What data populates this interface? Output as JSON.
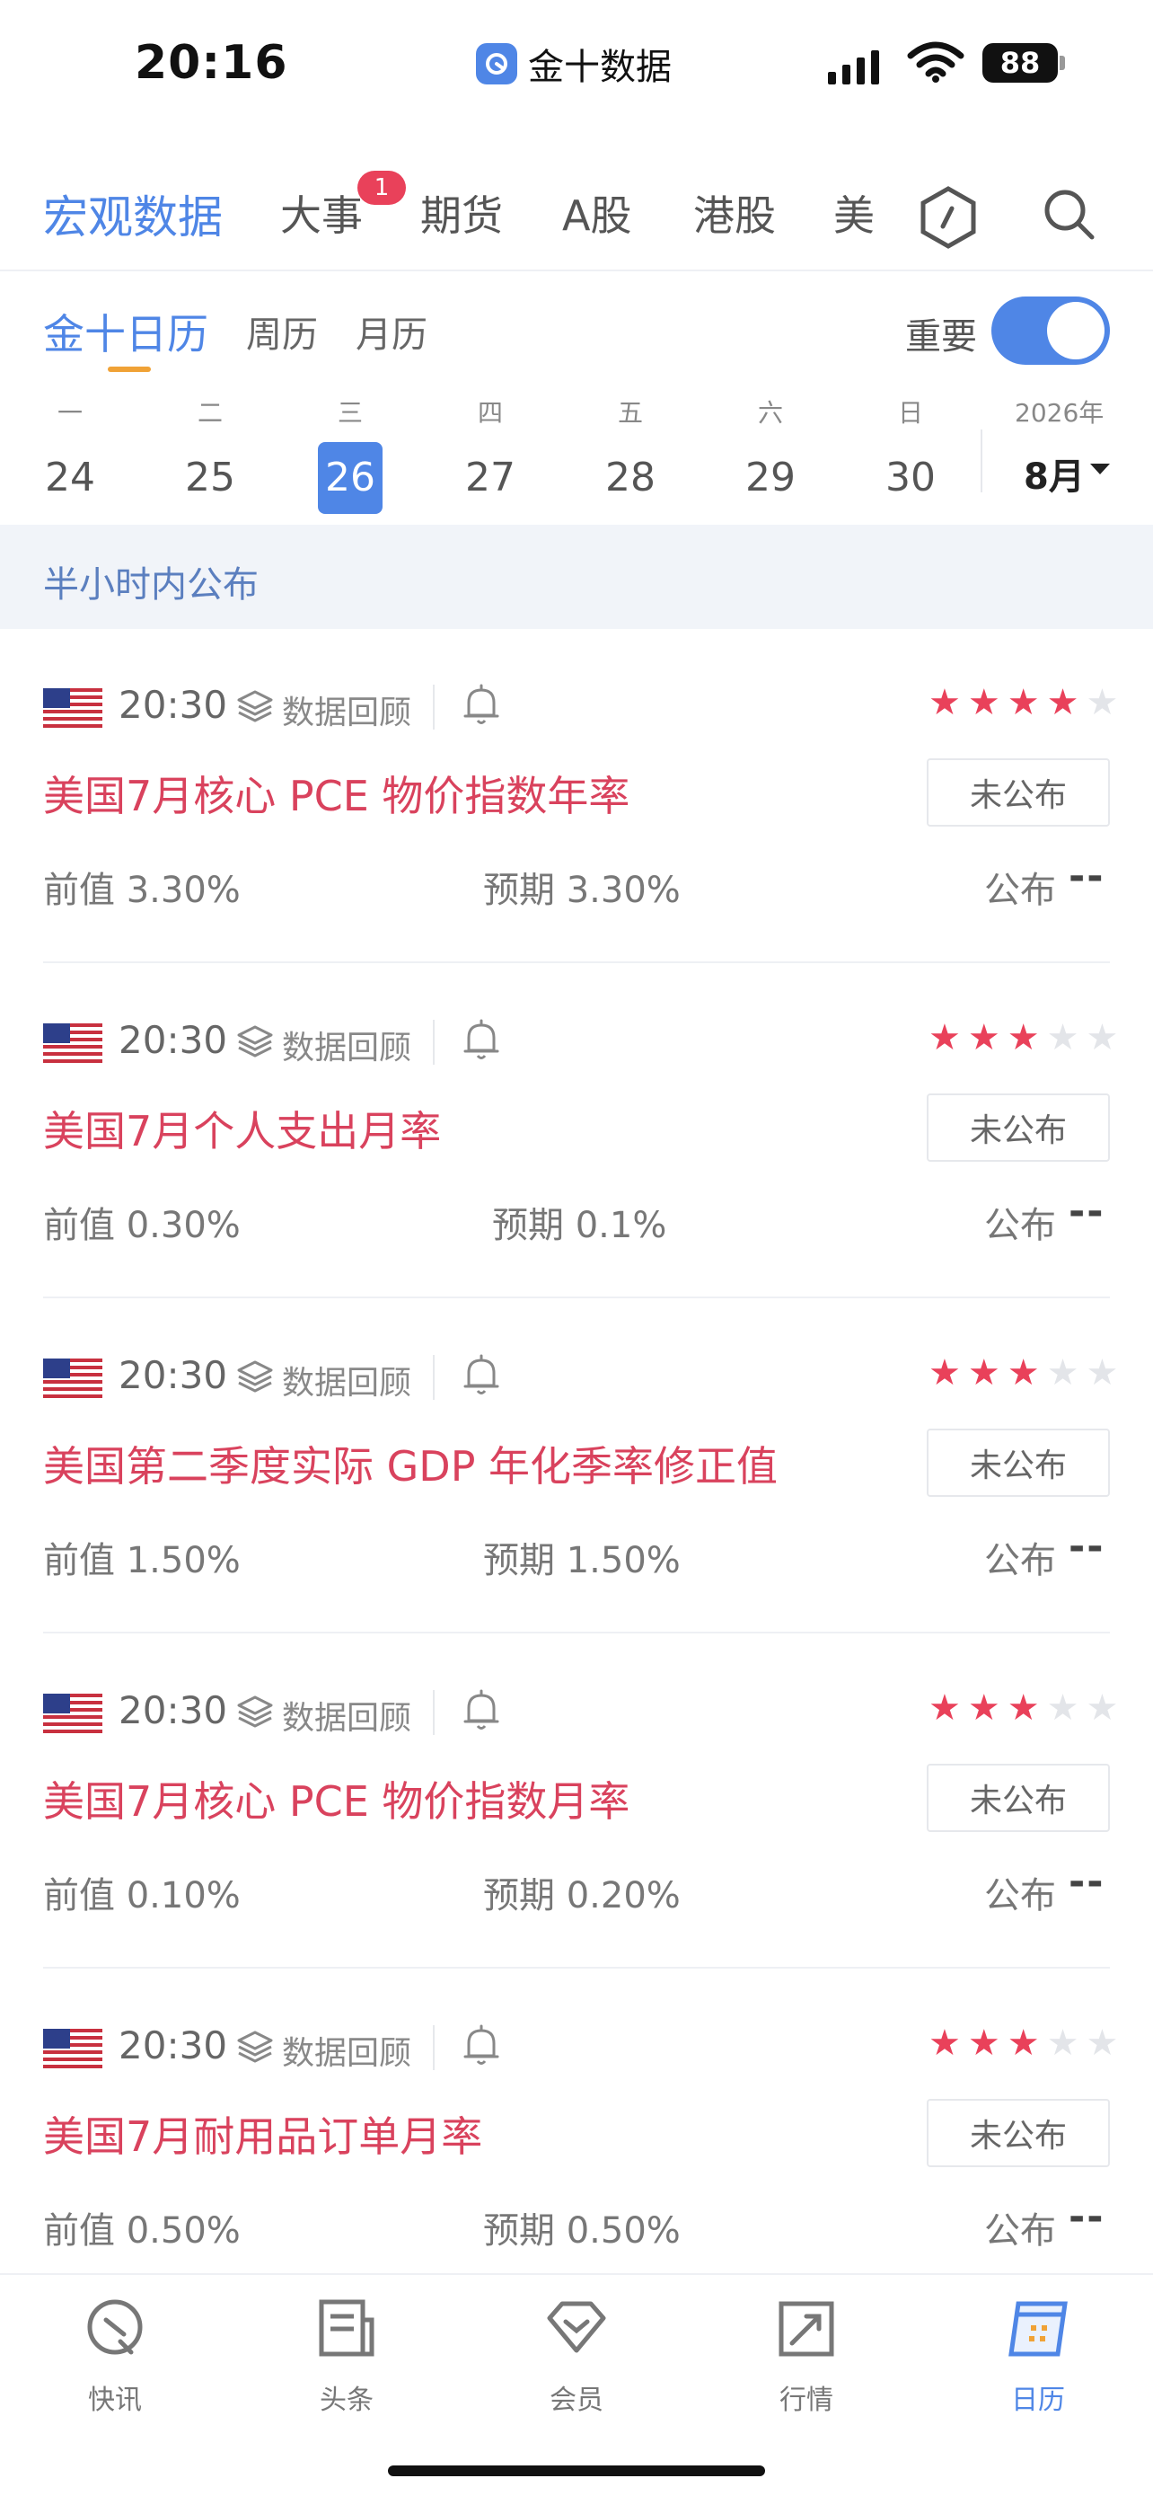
{
  "status_bar": {
    "time": "20:16",
    "app_name": "金十数据",
    "battery": "88"
  },
  "top_tabs": [
    {
      "label": "宏观数据",
      "active": true
    },
    {
      "label": "大事",
      "badge": "1"
    },
    {
      "label": "期货"
    },
    {
      "label": "A股"
    },
    {
      "label": "港股"
    },
    {
      "label": "美"
    }
  ],
  "top_icons": [
    "hexagon-icon",
    "search-icon"
  ],
  "sub_tabs": [
    {
      "label": "金十日历",
      "active": true
    },
    {
      "label": "周历"
    },
    {
      "label": "月历"
    }
  ],
  "important_toggle": {
    "label": "重要",
    "on": true
  },
  "week": {
    "weekdays": [
      "一",
      "二",
      "三",
      "四",
      "五",
      "六",
      "日"
    ],
    "days": [
      "24",
      "25",
      "26",
      "27",
      "28",
      "29",
      "30"
    ],
    "active_day": "26",
    "year": "2026年",
    "month": "8月"
  },
  "section": {
    "title": "半小时内公布"
  },
  "events": [
    {
      "time": "20:30",
      "review": "数据回顾",
      "stars": 4,
      "title": "美国7月核心 PCE 物价指数年率",
      "status": "未公布",
      "prev_label": "前值",
      "prev": "3.30%",
      "forecast_label": "预期",
      "forecast": "3.30%",
      "actual_label": "公布",
      "actual": "--"
    },
    {
      "time": "20:30",
      "review": "数据回顾",
      "stars": 3,
      "title": "美国7月个人支出月率",
      "status": "未公布",
      "prev_label": "前值",
      "prev": "0.30%",
      "forecast_label": "预期",
      "forecast": "0.1%",
      "actual_label": "公布",
      "actual": "--"
    },
    {
      "time": "20:30",
      "review": "数据回顾",
      "stars": 3,
      "title": "美国第二季度实际 GDP 年化季率修正值",
      "status": "未公布",
      "prev_label": "前值",
      "prev": "1.50%",
      "forecast_label": "预期",
      "forecast": "1.50%",
      "actual_label": "公布",
      "actual": "--"
    },
    {
      "time": "20:30",
      "review": "数据回顾",
      "stars": 3,
      "title": "美国7月核心 PCE 物价指数月率",
      "status": "未公布",
      "prev_label": "前值",
      "prev": "0.10%",
      "forecast_label": "预期",
      "forecast": "0.20%",
      "actual_label": "公布",
      "actual": "--"
    },
    {
      "time": "20:30",
      "review": "数据回顾",
      "stars": 3,
      "title": "美国7月耐用品订单月率",
      "status": "未公布",
      "prev_label": "前值",
      "prev": "0.50%",
      "forecast_label": "预期",
      "forecast": "0.50%",
      "actual_label": "公布",
      "actual": "--"
    }
  ],
  "bottom_nav": [
    {
      "label": "快讯",
      "icon": "compass-icon"
    },
    {
      "label": "头条",
      "icon": "newspaper-icon"
    },
    {
      "label": "会员",
      "icon": "diamond-icon"
    },
    {
      "label": "行情",
      "icon": "chart-icon"
    },
    {
      "label": "日历",
      "icon": "calendar-icon",
      "active": true
    }
  ],
  "colors": {
    "accent": "#4f86e6",
    "title_red": "#d9425d",
    "star_red": "#e9415a",
    "underline_orange": "#f0a236"
  }
}
